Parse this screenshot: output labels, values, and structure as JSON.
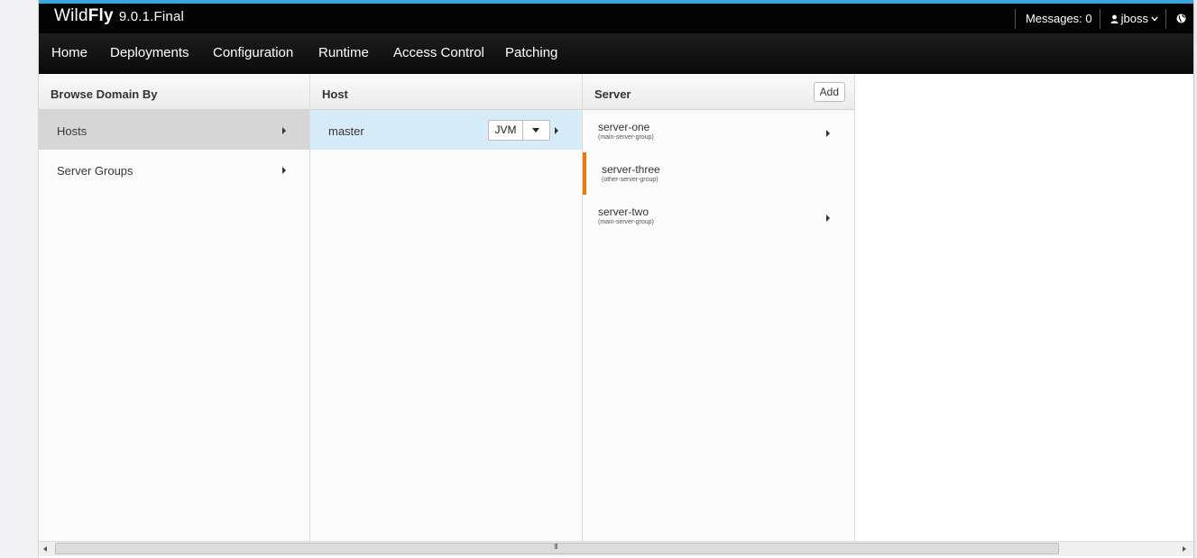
{
  "topbar": {
    "brand_wild": "Wild",
    "brand_fly": "Fly",
    "version": "9.0.1.Final",
    "messages": "Messages: 0",
    "user": "jboss"
  },
  "nav": [
    "Home",
    "Deployments",
    "Configuration",
    "Runtime",
    "Access Control",
    "Patching"
  ],
  "browse": {
    "header": "Browse Domain By",
    "items": [
      "Hosts",
      "Server Groups"
    ],
    "selected": "Hosts"
  },
  "host": {
    "header": "Host",
    "items": [
      {
        "name": "master",
        "action": "JVM"
      }
    ]
  },
  "server": {
    "header": "Server",
    "add_label": "Add",
    "items": [
      {
        "name": "server-one",
        "group": "(main-server-group)",
        "status": "running"
      },
      {
        "name": "server-three",
        "group": "(other-server-group)",
        "status": "stopped"
      },
      {
        "name": "server-two",
        "group": "(main-server-group)",
        "status": "running"
      }
    ]
  },
  "scrollbar": {
    "grip": "III"
  },
  "colors": {
    "accent_blue": "#39a5dc",
    "stopped_orange": "#ec7a08",
    "topbar": "#030303"
  }
}
